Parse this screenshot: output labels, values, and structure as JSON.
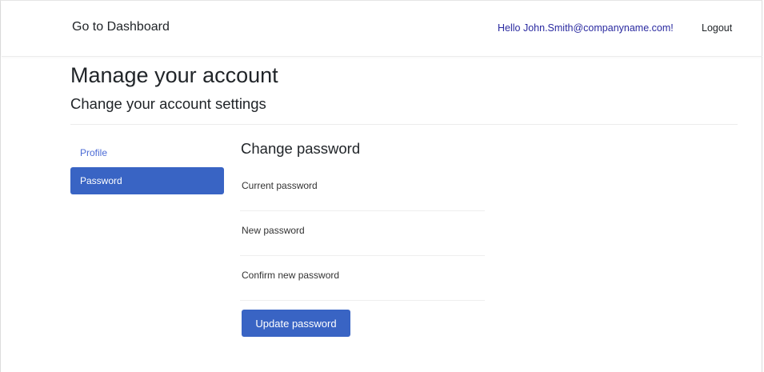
{
  "navbar": {
    "brand": "Go to Dashboard",
    "greeting": "Hello John.Smith@companyname.com!",
    "logout": "Logout"
  },
  "page": {
    "title": "Manage your account",
    "subtitle": "Change your account settings"
  },
  "sidebar": {
    "items": [
      {
        "label": "Profile",
        "active": false
      },
      {
        "label": "Password",
        "active": true
      }
    ]
  },
  "form": {
    "title": "Change password",
    "fields": [
      {
        "label": "Current password",
        "value": ""
      },
      {
        "label": "New password",
        "value": ""
      },
      {
        "label": "Confirm new password",
        "value": ""
      }
    ],
    "submit_label": "Update password"
  },
  "colors": {
    "accent": "#3964c4",
    "link": "#2a2aa0",
    "sidebar_link": "#4b6bd6"
  }
}
